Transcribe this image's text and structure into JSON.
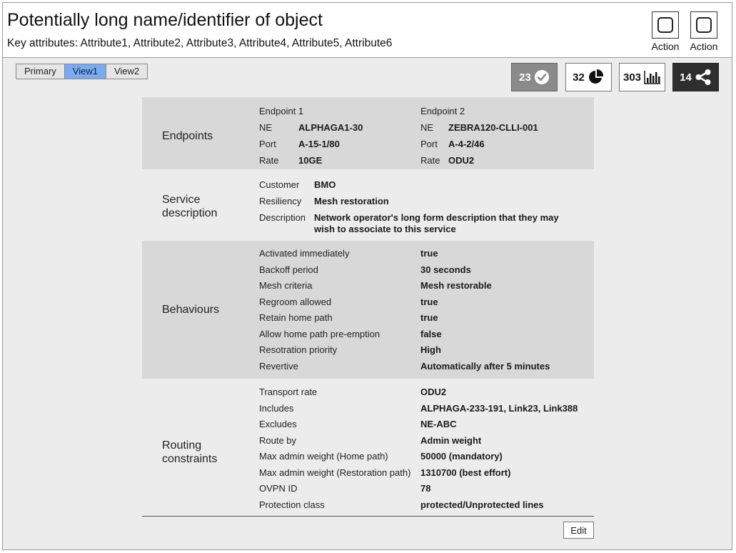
{
  "header": {
    "title": "Potentially long name/identifier of object",
    "subtitle": "Key attributes: Attribute1, Attribute2, Attribute3, Attribute4, Attribute5, Attribute6",
    "actions": [
      {
        "label": "Action"
      },
      {
        "label": "Action"
      }
    ]
  },
  "views": {
    "tabs": [
      {
        "label": "Primary"
      },
      {
        "label": "View1"
      },
      {
        "label": "View2"
      }
    ],
    "active": "View1"
  },
  "stats": [
    {
      "value": "23",
      "icon": "check-circle-icon"
    },
    {
      "value": "32",
      "icon": "pie-chart-icon"
    },
    {
      "value": "303",
      "icon": "bar-chart-icon"
    },
    {
      "value": "14",
      "icon": "share-icon"
    }
  ],
  "endpoints": {
    "title": "Endpoints",
    "endpoint1": {
      "heading": "Endpoint 1",
      "ne_label": "NE",
      "ne": "ALPHAGA1-30",
      "port_label": "Port",
      "port": "A-15-1/80",
      "rate_label": "Rate",
      "rate": "10GE"
    },
    "endpoint2": {
      "heading": "Endpoint 2",
      "ne_label": "NE",
      "ne": "ZEBRA120-CLLI-001",
      "port_label": "Port",
      "port": "A-4-2/46",
      "rate_label": "Rate",
      "rate": "ODU2"
    }
  },
  "service": {
    "title_line1": "Service",
    "title_line2": "description",
    "rows": [
      {
        "label": "Customer",
        "value": "BMO"
      },
      {
        "label": "Resiliency",
        "value": "Mesh restoration"
      },
      {
        "label": "Description",
        "value_line1": "Network operator's long form description that they may",
        "value_line2": "wish to associate to this service"
      }
    ]
  },
  "behaviours": {
    "title": "Behaviours",
    "rows": [
      {
        "label": "Activated immediately",
        "value": "true"
      },
      {
        "label": "Backoff period",
        "value": "30 seconds"
      },
      {
        "label": "Mesh criteria",
        "value": "Mesh restorable"
      },
      {
        "label": "Regroom allowed",
        "value": "true"
      },
      {
        "label": "Retain home path",
        "value": "true"
      },
      {
        "label": "Allow home path pre-emption",
        "value": "false"
      },
      {
        "label": "Resotration priority",
        "value": "High"
      },
      {
        "label": "Revertive",
        "value": "Automatically after 5 minutes"
      }
    ]
  },
  "routing": {
    "title_line1": "Routing",
    "title_line2": "constraints",
    "rows": [
      {
        "label": "Transport rate",
        "value": "ODU2"
      },
      {
        "label": "Includes",
        "value": "ALPHAGA-233-191, Link23, Link388"
      },
      {
        "label": "Excludes",
        "value": "NE-ABC"
      },
      {
        "label": "Route by",
        "value": "Admin weight"
      },
      {
        "label": "Max admin weight (Home path)",
        "value": "50000 (mandatory)"
      },
      {
        "label": "Max admin weight (Restoration path)",
        "value": "1310700 (best effort)"
      },
      {
        "label": "OVPN ID",
        "value": "78"
      },
      {
        "label": "Protection class",
        "value": "protected/Unprotected lines"
      }
    ]
  },
  "edit_label": "Edit"
}
